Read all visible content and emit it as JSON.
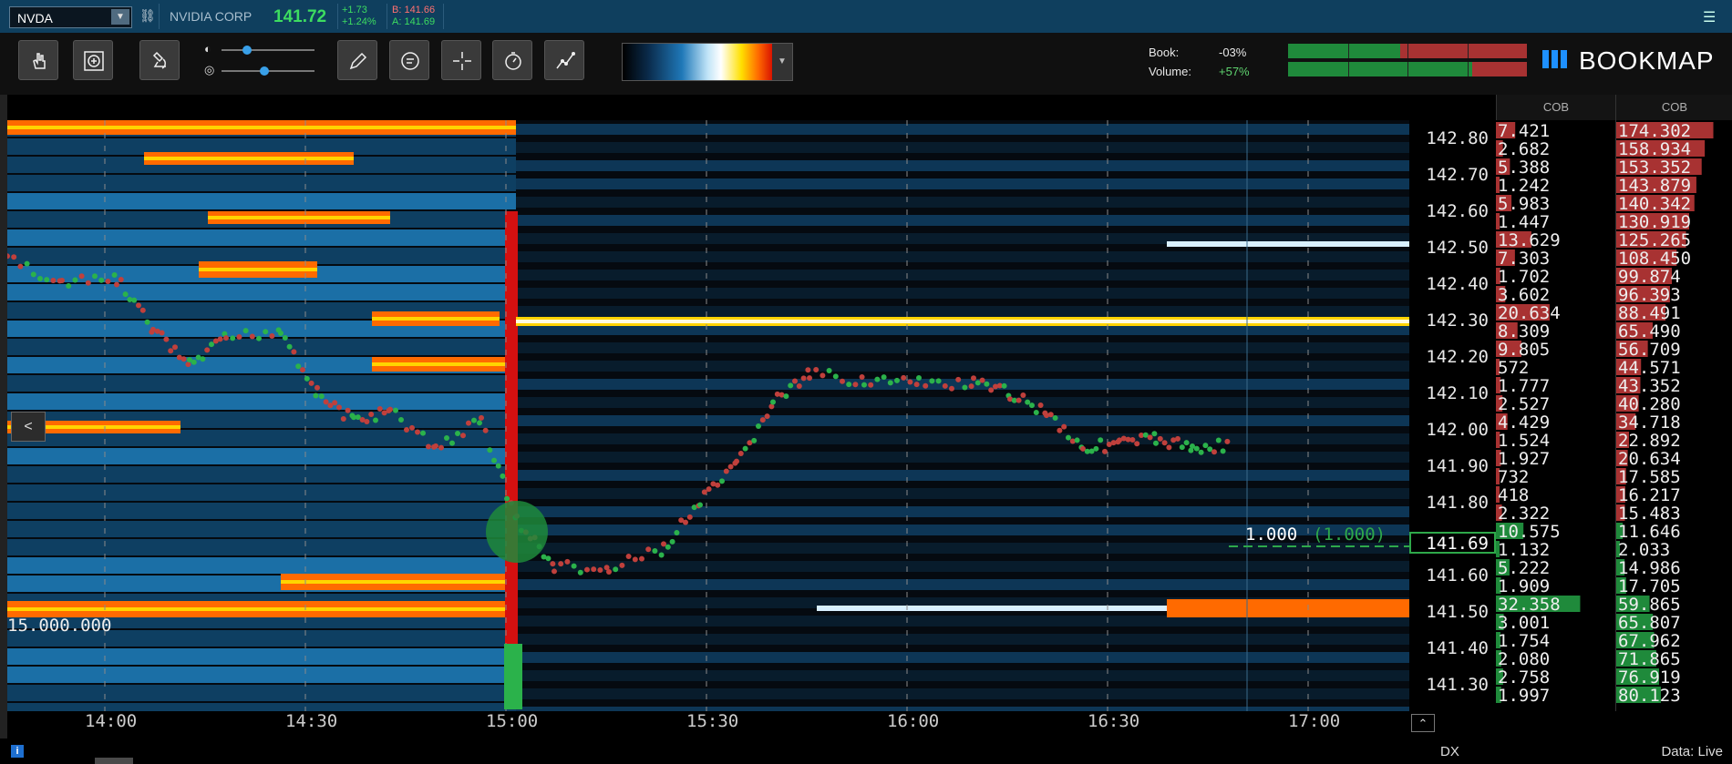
{
  "quote": {
    "symbol": "NVDA",
    "company": "NVIDIA CORP",
    "last": "141.72",
    "change_abs": "+1.73",
    "change_pct": "+1.24%",
    "bid": "B: 141.66",
    "ask": "A: 141.69"
  },
  "toolbar": {
    "book_label": "Book:",
    "book_value": "-03%",
    "volume_label": "Volume:",
    "volume_value": "+57%",
    "brand": "BOOKMAP",
    "book_meter": [
      [
        "#1f8a3b",
        0.47
      ],
      [
        "#a83232",
        0.53
      ]
    ],
    "volume_meter": [
      [
        "#1f8a3b",
        0.77
      ],
      [
        "#a83232",
        0.23
      ]
    ]
  },
  "chart": {
    "volume_label": "15.000.000",
    "collapse_label": "<",
    "last_trade_label": "1.000",
    "last_trade_paren": "(1.000)",
    "current_price": "141.69",
    "price_ticks": [
      "142.80",
      "142.70",
      "142.60",
      "142.50",
      "142.40",
      "142.30",
      "142.20",
      "142.10",
      "142.00",
      "141.90",
      "141.80",
      "141.60",
      "141.50",
      "141.40",
      "141.30"
    ],
    "time_ticks": [
      "14:00",
      "14:30",
      "15:00",
      "15:30",
      "16:00",
      "16:30",
      "17:00"
    ]
  },
  "cob": {
    "header1": "COB",
    "header2": "COB",
    "col1": [
      "7.421",
      "2.682",
      "5.388",
      "1.242",
      "5.983",
      "1.447",
      "13.629",
      "7.303",
      "1.702",
      "3.602",
      "20.634",
      "8.309",
      "9.805",
      "572",
      "1.777",
      "2.527",
      "4.429",
      "1.524",
      "1.927",
      "732",
      "418",
      "2.322",
      "10.575",
      "1.132",
      "5.222",
      "1.909",
      "32.358",
      "3.001",
      "1.754",
      "2.080",
      "2.758",
      "1.997"
    ],
    "col2": [
      "174.302",
      "158.934",
      "153.352",
      "143.879",
      "140.342",
      "130.919",
      "125.265",
      "108.450",
      "99.874",
      "96.393",
      "88.491",
      "65.490",
      "56.709",
      "44.571",
      "43.352",
      "40.280",
      "34.718",
      "22.892",
      "20.634",
      "17.585",
      "16.217",
      "15.483",
      "11.646",
      "2.033",
      "14.986",
      "17.705",
      "59.865",
      "65.807",
      "67.962",
      "71.865",
      "76.919",
      "80.123"
    ]
  },
  "status": {
    "dx": "DX",
    "data_status": "Data: Live"
  },
  "colors": {
    "bid_red": "#a83232",
    "ask_green": "#1f8a3b",
    "accent": "#39a0e8"
  }
}
